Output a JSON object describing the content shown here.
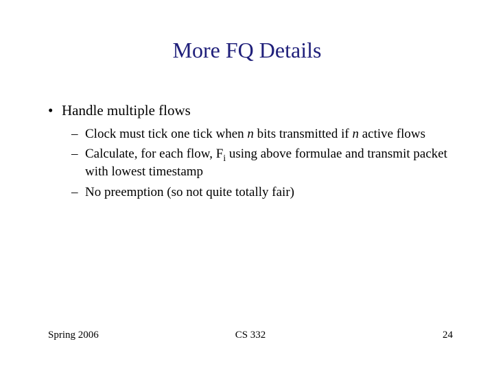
{
  "title": "More FQ Details",
  "bullets": {
    "l1": "Handle multiple flows",
    "sub1_a": "Clock must tick one tick when ",
    "sub1_n1": "n",
    "sub1_b": " bits transmitted if ",
    "sub1_n2": "n",
    "sub1_c": " active flows",
    "sub2_a": "Calculate, for each flow, F",
    "sub2_i": "i",
    "sub2_b": " using above formulae and transmit packet with lowest timestamp",
    "sub3": "No preemption (so not quite totally fair)"
  },
  "footer": {
    "left": "Spring 2006",
    "center": "CS 332",
    "right": "24"
  }
}
